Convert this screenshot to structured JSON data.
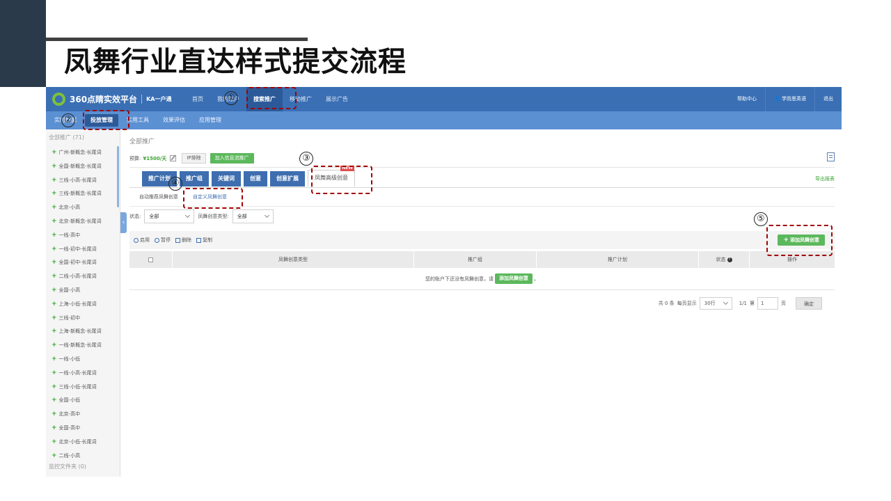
{
  "slide": {
    "title": "凤舞行业直达样式提交流程"
  },
  "app": {
    "logo_text": "360点睛实效平台",
    "logo_sub": "KA一户通",
    "nav": [
      {
        "label": "首页"
      },
      {
        "label": "我的账户"
      },
      {
        "label": "搜索推广"
      },
      {
        "label": "移动推广"
      },
      {
        "label": "展示广告"
      }
    ],
    "top_right": {
      "help": "帮助中心",
      "user": "学而思英语",
      "logout": "退出"
    },
    "subnav": [
      {
        "label": "实时数据"
      },
      {
        "label": "投放管理"
      },
      {
        "label": "实用工具"
      },
      {
        "label": "效果评估"
      },
      {
        "label": "应用管理"
      }
    ]
  },
  "sidebar": {
    "header": "全部推广 (71)",
    "items": [
      "广州-新概念-长尾词",
      "全国-新概念-长尾词",
      "三线-小高-长尾词",
      "三线-新概念-长尾词",
      "北京-小高",
      "北京-新概念-长尾词",
      "一线-高中",
      "一线-初中-长尾词",
      "全国-初中-长尾词",
      "二线-小高-长尾词",
      "全国-小高",
      "上海-小低-长尾词",
      "三线-初中",
      "上海-新概念-长尾词",
      "一线-新概念-长尾词",
      "一线-小低",
      "一线-小高-长尾词",
      "三线-小低-长尾词",
      "全国-小低",
      "北京-高中",
      "全国-高中",
      "北京-小低-长尾词",
      "二线-小高"
    ],
    "footer": "监控文件夹 (0)"
  },
  "main": {
    "breadcrumb": "全部推广",
    "budget_label": "预算:",
    "budget_value": "¥1500/天",
    "ip_button": "IP排除",
    "join_button": "加入信息流推广",
    "tabs": [
      "推广计划",
      "推广组",
      "关键词",
      "创意",
      "创意扩展",
      "凤舞高级创意"
    ],
    "new_badge": "NEW",
    "export_link": "导出报表",
    "subtabs": [
      "自动推荐凤舞创意",
      "自定义凤舞创意"
    ],
    "filters": {
      "status_label": "状态:",
      "status_value": "全部",
      "type_label": "凤舞创意类型:",
      "type_value": "全部"
    },
    "actions": [
      "启用",
      "暂停",
      "删除",
      "复制"
    ],
    "add_button": "添加凤舞创意",
    "table_headers": [
      "凤舞创意类型",
      "推广组",
      "推广计划",
      "状态",
      "操作"
    ],
    "empty_text_before": "您的账户下还没有凤舞创意，请",
    "empty_add_button": "添加凤舞创意",
    "empty_text_after": "。",
    "pager": {
      "total": "共 0 条",
      "per_page_label": "每页显示",
      "per_page_value": "30行",
      "pages": "1/1",
      "goto_label": "第",
      "goto_value": "1",
      "page_unit": "页",
      "confirm": "确定"
    }
  },
  "annotations": [
    "①",
    "②",
    "③",
    "④",
    "⑤"
  ],
  "colors": {
    "topbar": "#3a6fb4",
    "subbar": "#5b90d3",
    "green": "#5cb85c",
    "callout": "#a00000"
  }
}
